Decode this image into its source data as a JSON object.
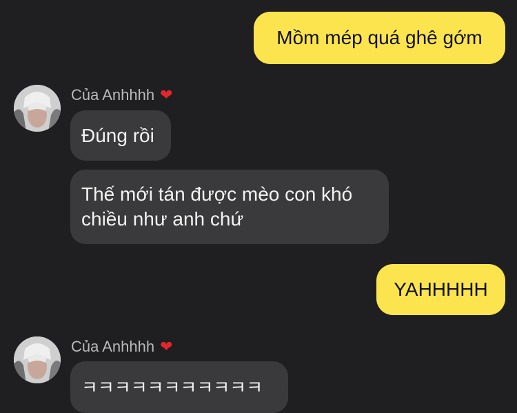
{
  "messages": [
    {
      "side": "out",
      "text": "Mồm mép quá ghê gớm"
    },
    {
      "side": "in",
      "sender": "Của Anhhhh",
      "text": "Đúng rồi"
    },
    {
      "side": "in",
      "text": "Thế mới tán được mèo con khó chiều như anh chứ"
    },
    {
      "side": "out",
      "text": "YAHHHHH"
    },
    {
      "side": "in",
      "sender": "Của Anhhhh",
      "text": "ㅋㅋㅋㅋㅋㅋㅋㅋㅋㅋㅋ"
    }
  ],
  "sender_heart": "❤",
  "colors": {
    "background": "#1f1f21",
    "outgoing_bubble": "#fbe44d",
    "incoming_bubble": "#3a3a3c",
    "sender_name": "#b9b9bd",
    "heart": "#e3262e"
  },
  "icons": {
    "heart": "heart-icon",
    "avatar": "avatar"
  }
}
